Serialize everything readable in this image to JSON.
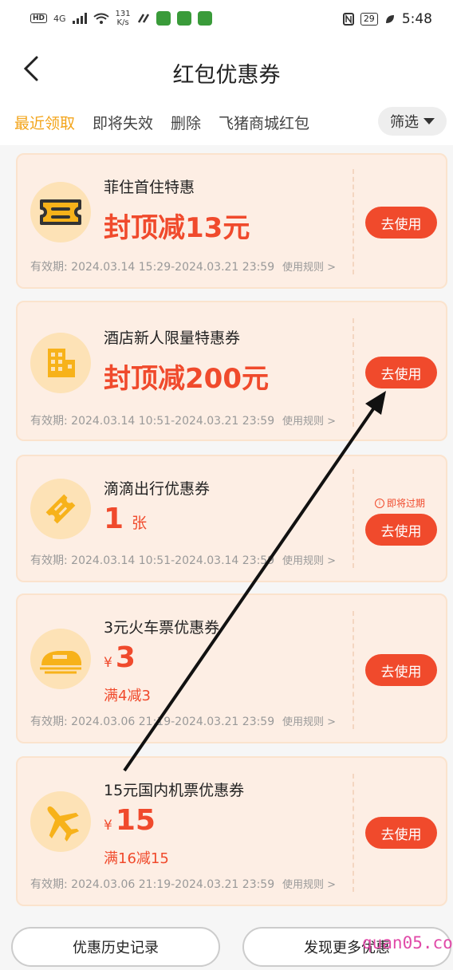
{
  "status_bar": {
    "hd": "HD",
    "network": "4G",
    "speed_value": "131",
    "speed_unit": "K/s",
    "battery": "29",
    "time": "5:48"
  },
  "header": {
    "title": "红包优惠券"
  },
  "tabs": {
    "recent": "最近领取",
    "expiring": "即将失效",
    "delete": "删除",
    "mall": "飞猪商城红包",
    "filter": "筛选"
  },
  "coupons": [
    {
      "title": "菲住首住特惠",
      "amount": "封顶减13元",
      "validity": "有效期: 2024.03.14 15:29-2024.03.21 23:59",
      "rule": "使用规则 >",
      "button": "去使用",
      "icon": "ticket-icon"
    },
    {
      "title": "酒店新人限量特惠券",
      "amount": "封顶减200元",
      "validity": "有效期: 2024.03.14 10:51-2024.03.21 23:59",
      "rule": "使用规则 >",
      "button": "去使用",
      "icon": "hotel-building-icon"
    },
    {
      "title": "滴滴出行优惠券",
      "count": "1",
      "unit": "张",
      "validity": "有效期: 2024.03.14 10:51-2024.03.14 23:59",
      "rule": "使用规则 >",
      "button": "去使用",
      "warning": "即将过期",
      "icon": "ride-ticket-icon"
    },
    {
      "title": "3元火车票优惠券",
      "currency": "¥",
      "value": "3",
      "condition": "满4减3",
      "validity": "有效期: 2024.03.06 21:19-2024.03.21 23:59",
      "rule": "使用规则 >",
      "button": "去使用",
      "icon": "train-icon"
    },
    {
      "title": "15元国内机票优惠券",
      "currency": "¥",
      "value": "15",
      "condition": "满16减15",
      "validity": "有效期: 2024.03.06 21:19-2024.03.21 23:59",
      "rule": "使用规则 >",
      "button": "去使用",
      "icon": "airplane-icon"
    }
  ],
  "footer": {
    "history": "优惠历史记录",
    "discover": "发现更多优惠"
  },
  "watermark": "quan05.com",
  "colors": {
    "accent_orange": "#f3a41a",
    "primary_red": "#f04a2c",
    "card_bg": "#fdeee4",
    "icon_bg": "#fde2b6"
  }
}
